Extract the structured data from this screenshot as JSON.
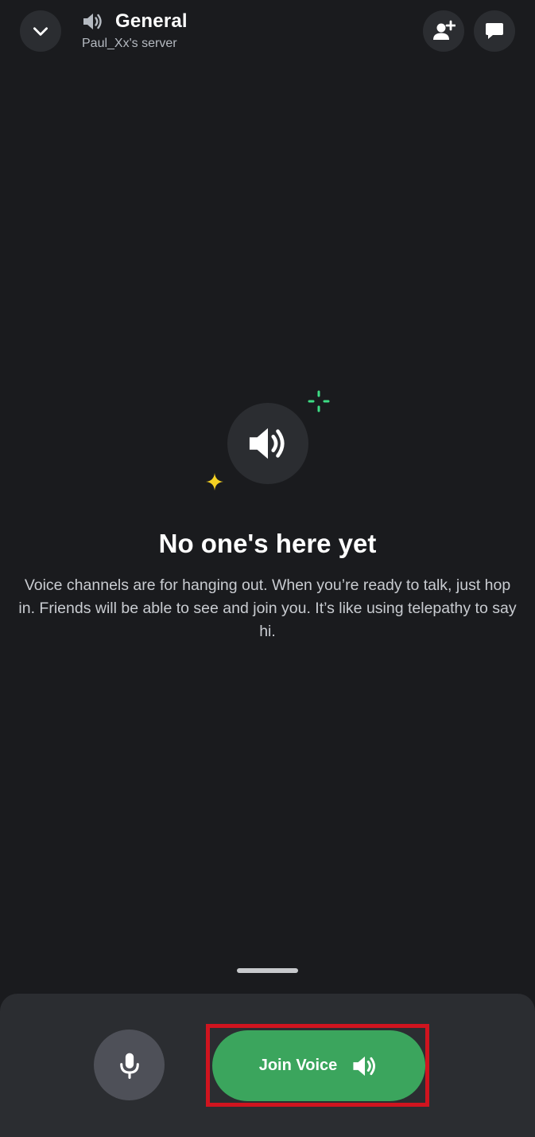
{
  "header": {
    "channel_name": "General",
    "server_name": "Paul_Xx's server",
    "collapse_icon": "chevron-down-icon",
    "channel_type_icon": "speaker-icon",
    "invite_icon": "add-person-icon",
    "chat_icon": "chat-bubble-icon"
  },
  "empty_state": {
    "icon": "speaker-icon",
    "title": "No one's here yet",
    "description": "Voice channels are for hanging out. When you’re ready to talk, just hop in. Friends will be able to see and join you. It’s like using telepathy to say hi."
  },
  "controls": {
    "mic_icon": "microphone-icon",
    "join_label": "Join Voice",
    "join_icon": "speaker-icon"
  },
  "colors": {
    "background": "#1a1b1e",
    "surface": "#2b2d31",
    "join_green": "#3ba55d",
    "highlight_red": "#d0141f",
    "sparkle_green": "#3ddc84",
    "sparkle_yellow": "#f5d123"
  }
}
